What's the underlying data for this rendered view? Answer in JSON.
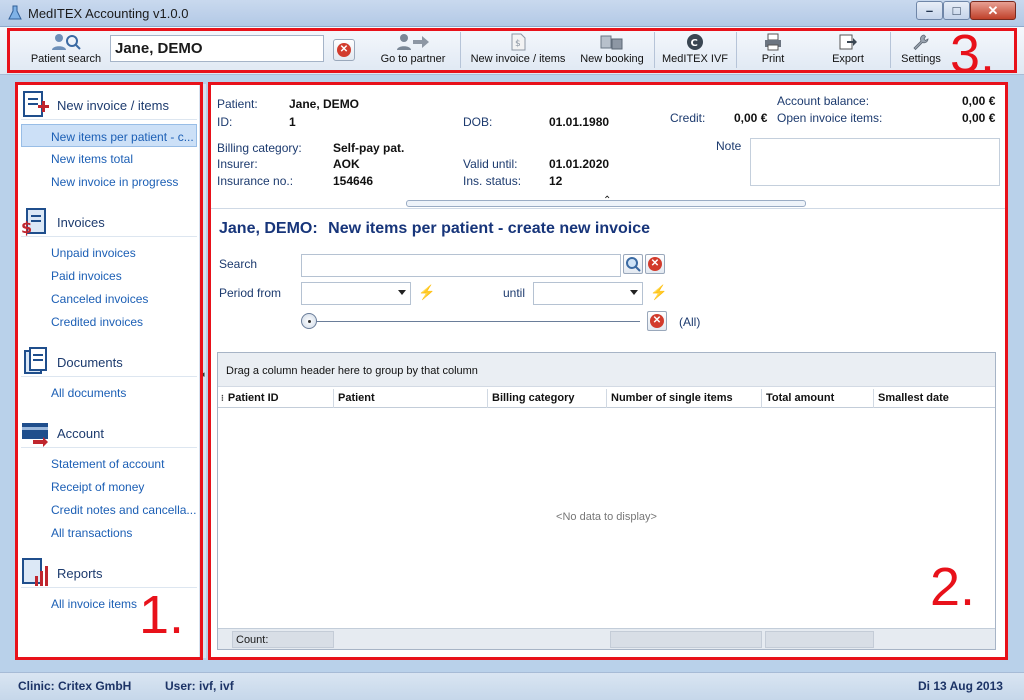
{
  "window": {
    "title": "MedITEX Accounting v1.0.0",
    "controls": [
      "minimize",
      "maximize",
      "close"
    ]
  },
  "toolbar": {
    "patient_search_label": "Patient search",
    "patient_field_value": "Jane, DEMO",
    "go_to_partner_label": "Go to partner",
    "new_invoice_label": "New invoice / items",
    "new_booking_label": "New booking",
    "meditex_ivf_label": "MedITEX IVF",
    "print_label": "Print",
    "export_label": "Export",
    "settings_label": "Settings"
  },
  "annotations": [
    "1.",
    "2.",
    "3."
  ],
  "sidebar": {
    "groups": [
      {
        "label": "New invoice / items",
        "icon": "new-invoice-icon",
        "items": [
          "New items per patient - c...",
          "New items total",
          "New invoice in progress"
        ],
        "selected": 0
      },
      {
        "label": "Invoices",
        "icon": "invoices-icon",
        "items": [
          "Unpaid invoices",
          "Paid invoices",
          "Canceled invoices",
          "Credited invoices"
        ]
      },
      {
        "label": "Documents",
        "icon": "documents-icon",
        "items": [
          "All documents"
        ]
      },
      {
        "label": "Account",
        "icon": "account-icon",
        "items": [
          "Statement of account",
          "Receipt of money",
          "Credit notes and cancella...",
          "All transactions"
        ]
      },
      {
        "label": "Reports",
        "icon": "reports-icon",
        "items": [
          "All invoice items"
        ]
      }
    ]
  },
  "patient_info": {
    "patient_label": "Patient:",
    "patient_value": "Jane, DEMO",
    "id_label": "ID:",
    "id_value": "1",
    "dob_label": "DOB:",
    "dob_value": "01.01.1980",
    "credit_label": "Credit:",
    "credit_value": "0,00 €",
    "account_balance_label": "Account balance:",
    "account_balance_value": "0,00 €",
    "open_items_label": "Open invoice items:",
    "open_items_value": "0,00 €",
    "billing_category_label": "Billing category:",
    "billing_category_value": "Self-pay pat.",
    "insurer_label": "Insurer:",
    "insurer_value": "AOK",
    "insurance_no_label": "Insurance no.:",
    "insurance_no_value": "154646",
    "valid_until_label": "Valid until:",
    "valid_until_value": "01.01.2020",
    "ins_status_label": "Ins. status:",
    "ins_status_value": "12",
    "note_label": "Note"
  },
  "main": {
    "title_patient": "Jane, DEMO:",
    "title_text": "New items per patient - create new invoice",
    "search_label": "Search",
    "search_value": "",
    "period_from_label": "Period from",
    "until_label": "until",
    "slider_value_label": "(All)",
    "grid": {
      "group_hint": "Drag a column header here to group by that column",
      "columns": [
        "Patient ID",
        "Patient",
        "Billing category",
        "Number of single items",
        "Total amount",
        "Smallest date"
      ],
      "rows": [],
      "empty_text": "<No data to display>",
      "footer_count_label": "Count:"
    }
  },
  "statusbar": {
    "clinic": "Clinic: Critex GmbH",
    "user": "User: ivf, ivf",
    "date": "Di 13 Aug 2013"
  }
}
